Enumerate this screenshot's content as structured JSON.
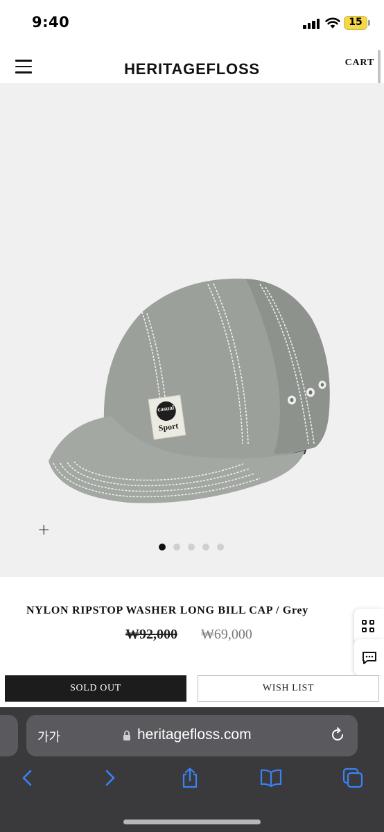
{
  "status_bar": {
    "time": "9:40",
    "battery": "15"
  },
  "header": {
    "brand": "HERITAGEFLOSS",
    "cart": "CART"
  },
  "product_image": {
    "patch_line1": "casual",
    "patch_line2": "Sport",
    "zoom_symbol": "+",
    "slide_count": 5,
    "active_slide": 1
  },
  "product": {
    "title": "NYLON RIPSTOP WASHER LONG BILL CAP / Grey",
    "original_price": "₩92,000",
    "sale_price": "₩69,000"
  },
  "actions": {
    "sold_out": "SOLD OUT",
    "wish_list": "WISH LIST"
  },
  "browser": {
    "text_size": "가가",
    "url": "heritagefloss.com"
  },
  "colors": {
    "accent_blue": "#3a82f7",
    "button_dark": "#1c1c1c",
    "image_bg": "#f0f0f0",
    "battery": "#f6d74a"
  },
  "icons": [
    "menu-icon",
    "signal-icon",
    "wifi-icon",
    "battery-icon",
    "grid-icon",
    "chat-icon",
    "lock-icon",
    "reload-icon",
    "back-icon",
    "forward-icon",
    "share-icon",
    "bookmarks-icon",
    "tabs-icon"
  ]
}
